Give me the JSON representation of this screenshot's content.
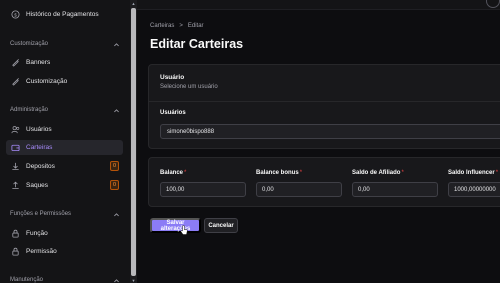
{
  "sidebar": {
    "items": [
      {
        "label": "Histórico de Pagamentos",
        "icon": "dollar-circle-icon"
      },
      {
        "label": "Banners",
        "icon": "brush-icon"
      },
      {
        "label": "Customização",
        "icon": "brush-icon"
      },
      {
        "label": "Usuários",
        "icon": "users-icon"
      },
      {
        "label": "Carteiras",
        "icon": "wallet-icon"
      },
      {
        "label": "Depositos",
        "icon": "download-icon",
        "badge": "0"
      },
      {
        "label": "Saques",
        "icon": "upload-icon",
        "badge": "0"
      },
      {
        "label": "Função",
        "icon": "lock-icon"
      },
      {
        "label": "Permissão",
        "icon": "lock-icon"
      }
    ],
    "sections": [
      "Customização",
      "Administração",
      "Funções e Permissões",
      "Manutenção"
    ]
  },
  "breadcrumb": {
    "root": "Carteiras",
    "separator": ">",
    "current": "Editar"
  },
  "page": {
    "title": "Editar Carteiras"
  },
  "user_section": {
    "title": "Usuário",
    "subtitle": "Selecione um usuário",
    "field_label": "Usuários",
    "selected_value": "simone0bispo888"
  },
  "balances": {
    "fields": [
      {
        "label": "Balance",
        "required": "*",
        "value": "100,00"
      },
      {
        "label": "Balance bonus",
        "required": "*",
        "value": "0,00"
      },
      {
        "label": "Saldo de Afiliado",
        "required": "*",
        "value": "0,00"
      },
      {
        "label": "Saldo Influencer",
        "required": "*",
        "value": "1000,00000000"
      }
    ]
  },
  "actions": {
    "save_label": "Salvar alterações",
    "cancel_label": "Cancelar"
  },
  "colors": {
    "accent": "#8b7cf6",
    "active_nav": "#a78bfa",
    "required": "#ef4444",
    "badge": "#fb923c"
  }
}
